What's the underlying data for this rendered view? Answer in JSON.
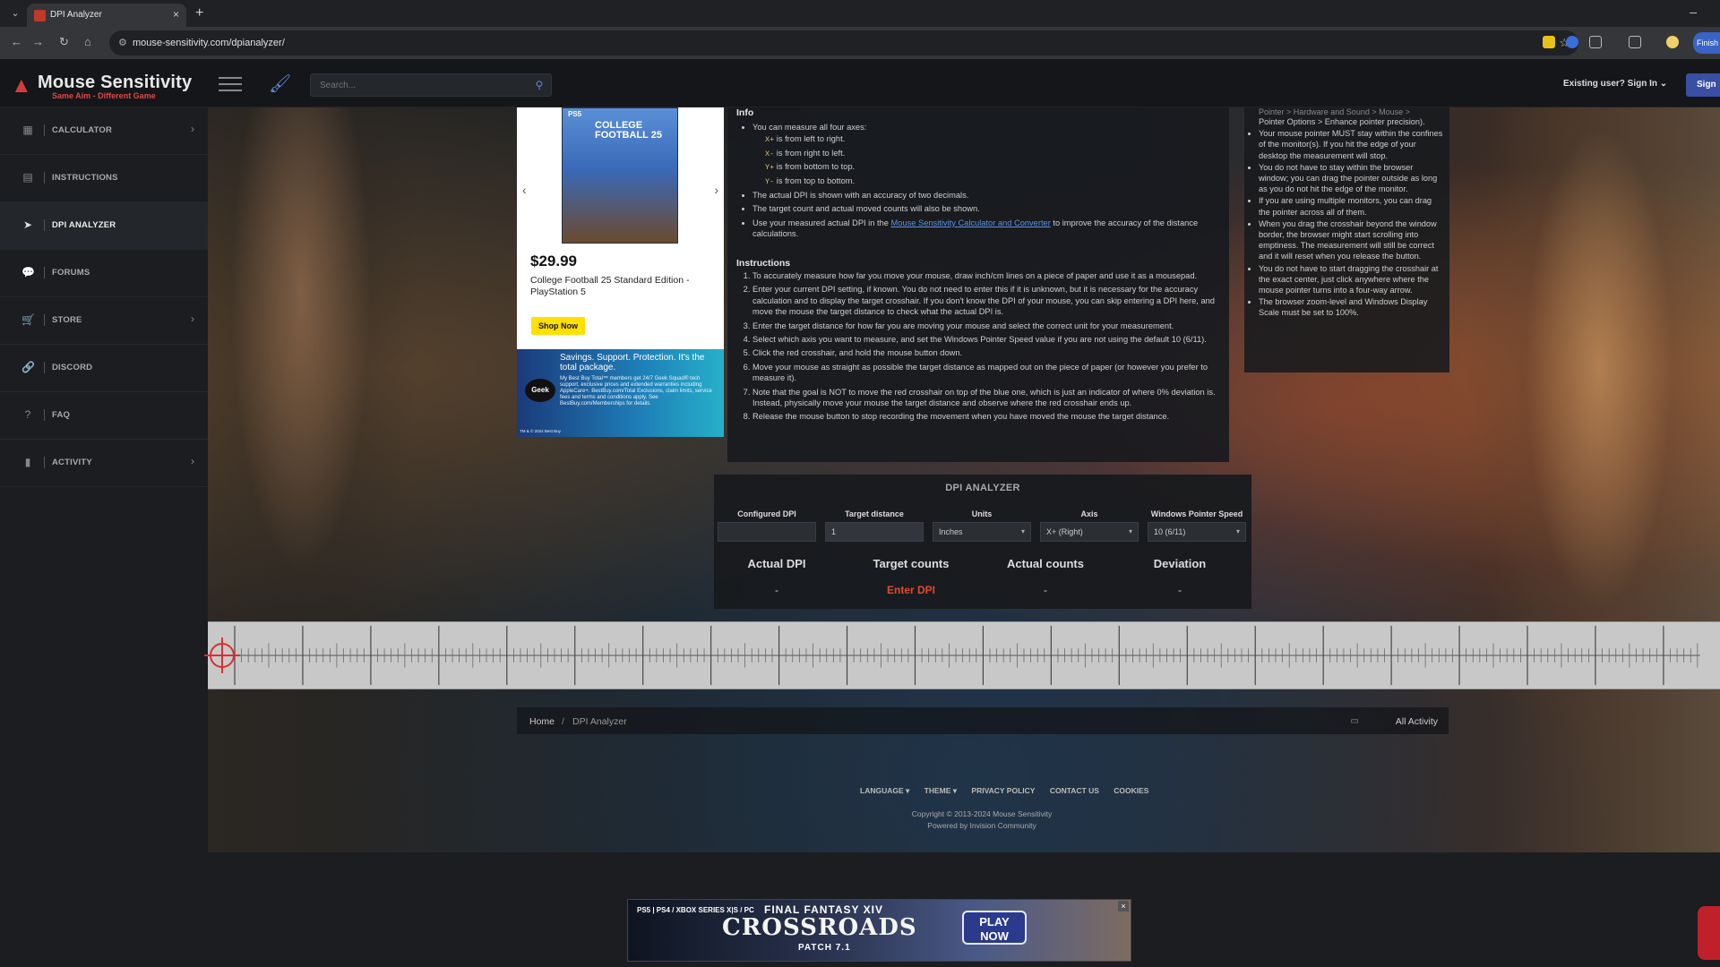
{
  "browser": {
    "tab_title": "DPI Analyzer",
    "url": "mouse-sensitivity.com/dpianalyzer/",
    "profile_button": "Finish"
  },
  "header": {
    "logo_name": "Mouse Sensitivity",
    "logo_tagline": "Same Aim - Different Game",
    "search_placeholder": "Search...",
    "signin_text": "Existing user? Sign In",
    "signup_text": "Sign"
  },
  "sidebar": {
    "items": [
      {
        "label": "CALCULATOR",
        "icon": "calculator-icon"
      },
      {
        "label": "INSTRUCTIONS",
        "icon": "book-icon"
      },
      {
        "label": "DPI ANALYZER",
        "icon": "cursor-icon"
      },
      {
        "label": "FORUMS",
        "icon": "chat-icon"
      },
      {
        "label": "STORE",
        "icon": "cart-icon"
      },
      {
        "label": "DISCORD",
        "icon": "link-icon"
      },
      {
        "label": "FAQ",
        "icon": "help-icon"
      },
      {
        "label": "ACTIVITY",
        "icon": "chart-icon"
      }
    ]
  },
  "product_ad": {
    "platform": "PS5",
    "cover_title": "COLLEGE FOOTBALL 25",
    "price": "$29.99",
    "description": "College Football 25 Standard Edition - PlayStation 5",
    "button": "Shop Now"
  },
  "geek_ad": {
    "logo": "Geek",
    "headline": "Savings. Support. Protection. It's the total package.",
    "fine_print": "My Best Buy Total™ members get 24/7 Geek Squad® tech support, exclusive prices and extended warranties including AppleCare+. BestBuy.com/Total Exclusions, claim limits, service fees and terms and conditions apply. See BestBuy.com/Memberships for details.",
    "footer": "TM & © 2024 Best Buy"
  },
  "info": {
    "heading": "Info",
    "axis_intro": "You can measure all four axes:",
    "axes": [
      {
        "code": "X+",
        "text": "is from left to right."
      },
      {
        "code": "X-",
        "text": "is from right to left."
      },
      {
        "code": "Y+",
        "text": "is from bottom to top."
      },
      {
        "code": "Y-",
        "text": "is from top to bottom."
      }
    ],
    "notes": [
      "The actual DPI is shown with an accuracy of two decimals.",
      "The target count and actual moved counts will also be shown."
    ],
    "use_pre": "Use your measured actual DPI in the",
    "use_link": "Mouse Sensitivity Calculator and Converter",
    "use_post": "to improve the accuracy of the distance calculations.",
    "instructions_heading": "Instructions",
    "steps": [
      "To accurately measure how far you move your mouse, draw inch/cm lines on a piece of paper and use it as a mousepad.",
      "Enter your current DPI setting, if known. You do not need to enter this if it is unknown, but it is necessary for the accuracy calculation and to display the target crosshair. If you don't know the DPI of your mouse, you can skip entering a DPI here, and move the mouse the target distance to check what the actual DPI is.",
      "Enter the target distance for how far you are moving your mouse and select the correct unit for your measurement.",
      "Select which axis you want to measure, and set the Windows Pointer Speed value if you are not using the default 10 (6/11).",
      "Click the red crosshair, and hold the mouse button down.",
      "Move your mouse as straight as possible the target distance as mapped out on the piece of paper (or however you prefer to measure it).",
      "Note that the goal is NOT to move the red crosshair on top of the blue one, which is just an indicator of where 0% deviation is. Instead, physically move your mouse the target distance and observe where the red crosshair ends up.",
      "Release the mouse button to stop recording the movement when you have moved the mouse the target distance."
    ]
  },
  "right_panel": {
    "cut_line": "Pointer > Hardware and Sound > Mouse >",
    "items": [
      "Pointer Options > Enhance pointer precision).",
      "Your mouse pointer MUST stay within the confines of the monitor(s). If you hit the edge of your desktop the measurement will stop.",
      "You do not have to stay within the browser window; you can drag the pointer outside as long as you do not hit the edge of the monitor.",
      "If you are using multiple monitors, you can drag the pointer across all of them.",
      "When you drag the crosshair beyond the window border, the browser might start scrolling into emptiness. The measurement will still be correct and it will reset when you release the button.",
      "You do not have to start dragging the crosshair at the exact center, just click anywhere where the mouse pointer turns into a four-way arrow.",
      "The browser zoom-level and Windows Display Scale must be set to 100%."
    ]
  },
  "analyzer": {
    "title": "DPI ANALYZER",
    "fields": {
      "configured_dpi_label": "Configured DPI",
      "configured_dpi_value": "",
      "target_distance_label": "Target distance",
      "target_distance_value": "1",
      "units_label": "Units",
      "units_value": "Inches",
      "axis_label": "Axis",
      "axis_value": "X+ (Right)",
      "pointer_speed_label": "Windows Pointer Speed",
      "pointer_speed_value": "10 (6/11)"
    },
    "results": {
      "actual_dpi_label": "Actual DPI",
      "actual_dpi_value": "-",
      "target_counts_label": "Target counts",
      "target_counts_value": "Enter DPI",
      "actual_counts_label": "Actual counts",
      "actual_counts_value": "-",
      "deviation_label": "Deviation",
      "deviation_value": "-"
    },
    "warn_color": "#e2492f"
  },
  "breadcrumb": {
    "home": "Home",
    "current": "DPI Analyzer",
    "activity": "All Activity"
  },
  "footer": {
    "links": [
      "LANGUAGE ▾",
      "THEME ▾",
      "PRIVACY POLICY",
      "CONTACT US",
      "COOKIES"
    ],
    "copyright": "Copyright © 2013-2024 Mouse Sensitivity",
    "powered": "Powered by Invision Community"
  },
  "banner_ad": {
    "platforms": "PS5 | PS4 / XBOX SERIES X|S / PC",
    "line1": "FINAL FANTASY XIV",
    "line2": "CROSSROADS",
    "line3": "PATCH 7.1",
    "button": "PLAY NOW"
  }
}
